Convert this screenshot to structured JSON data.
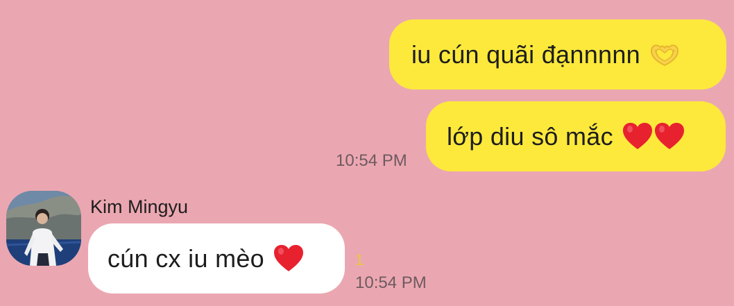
{
  "chat": {
    "messages": [
      {
        "direction": "outgoing",
        "text": "iu cún quãi đạnnnnn",
        "emoji": "heart-hands-icon"
      },
      {
        "direction": "outgoing",
        "text": "lớp diu sô mắc",
        "emoji": "two-red-hearts-icon"
      },
      {
        "direction": "incoming",
        "sender": "Kim Mingyu",
        "text": "cún cx iu mèo",
        "emoji": "red-heart-icon",
        "unread_count": "1"
      }
    ],
    "timestamps": {
      "outgoing": "10:54 PM",
      "incoming": "10:54 PM"
    }
  },
  "colors": {
    "background": "#eba7b1",
    "outgoing_bubble": "#fde93c",
    "incoming_bubble": "#ffffff",
    "heart": "#e8212f",
    "unread_badge": "#e7c93a"
  }
}
